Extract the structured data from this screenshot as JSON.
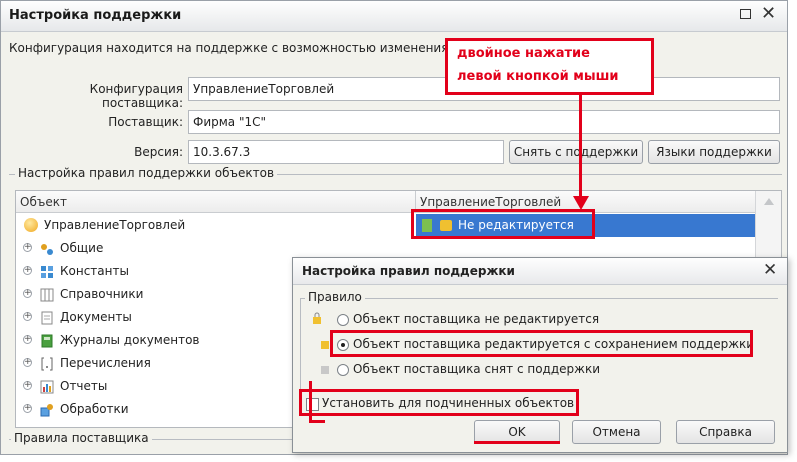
{
  "window": {
    "title": "Настройка поддержки",
    "info": "Конфигурация находится на поддержке с возможностью изменения",
    "vendor_config_label": "Конфигурация поставщика:",
    "vendor_config_value": "УправлениеТорговлей",
    "supplier_label": "Поставщик:",
    "supplier_value": "Фирма \"1С\"",
    "version_label": "Версия:",
    "version_value": "10.3.67.3",
    "btn_remove_support": "Снять с поддержки",
    "btn_support_languages": "Языки поддержки",
    "group_rules": "Настройка правил поддержки объектов",
    "group_vendor_rules": "Правила поставщика"
  },
  "annotation": {
    "line1": "двойное нажатие",
    "line2": "левой кнопкой мыши"
  },
  "tree": {
    "col_object": "Объект",
    "col_config": "УправлениеТорговлей",
    "root": {
      "label": "УправлениеТорговлей",
      "status": "Не редактируется"
    },
    "items": [
      {
        "label": "Общие",
        "icon": "common-icon"
      },
      {
        "label": "Константы",
        "icon": "constants-icon"
      },
      {
        "label": "Справочники",
        "icon": "catalogs-icon"
      },
      {
        "label": "Документы",
        "icon": "documents-icon"
      },
      {
        "label": "Журналы документов",
        "icon": "journals-icon"
      },
      {
        "label": "Перечисления",
        "icon": "enums-icon"
      },
      {
        "label": "Отчеты",
        "icon": "reports-icon"
      },
      {
        "label": "Обработки",
        "icon": "processing-icon"
      }
    ]
  },
  "dialog": {
    "title": "Настройка правил поддержки",
    "group": "Правило",
    "options": [
      "Объект поставщика не редактируется",
      "Объект поставщика редактируется с сохранением поддержки",
      "Объект поставщика снят с поддержки"
    ],
    "selected_option": 2,
    "checkbox_label": "Установить для подчиненных объектов",
    "checkbox_checked": false,
    "ok": "OK",
    "cancel": "Отмена",
    "help": "Справка"
  },
  "colors": {
    "selection": "#3878d0",
    "annotation_red": "#e2001a",
    "window_bg": "#f2f2ec"
  }
}
